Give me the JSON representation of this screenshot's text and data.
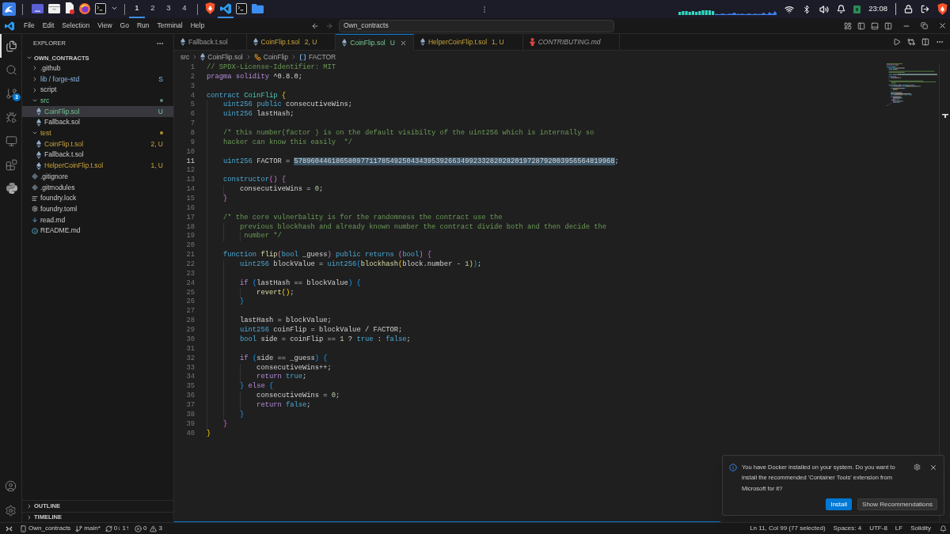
{
  "os_bar": {
    "launchers": [
      {
        "kind": "window",
        "active": false
      },
      {
        "kind": "files",
        "active": false
      },
      {
        "kind": "document",
        "active": false
      },
      {
        "kind": "globe",
        "active": false
      },
      {
        "kind": "terminal",
        "active": false
      },
      {
        "kind": "caret",
        "active": false
      }
    ],
    "workspaces": [
      {
        "label": "1",
        "selected": true
      },
      {
        "label": "2",
        "selected": false
      },
      {
        "label": "3",
        "selected": false
      },
      {
        "label": "4",
        "selected": false
      }
    ],
    "pinned": [
      {
        "kind": "shield",
        "active": false
      },
      {
        "kind": "editor",
        "active": true
      },
      {
        "kind": "terminal",
        "active": false
      },
      {
        "kind": "folder",
        "active": false
      }
    ],
    "clock": "23:08"
  },
  "title_bar": {
    "menus": [
      "File",
      "Edit",
      "Selection",
      "View",
      "Go",
      "Run",
      "Terminal",
      "Help"
    ],
    "search": {
      "value": "Own_contracts"
    }
  },
  "activity_bar": {
    "items": [
      {
        "kind": "files",
        "selected": true
      },
      {
        "kind": "search",
        "selected": false
      },
      {
        "kind": "scm",
        "selected": false,
        "badge": "3"
      },
      {
        "kind": "debug",
        "selected": false
      },
      {
        "kind": "remote",
        "selected": false
      },
      {
        "kind": "extensions",
        "selected": false
      },
      {
        "kind": "python",
        "selected": false
      }
    ]
  },
  "sidebar": {
    "title": "EXPLORER",
    "root": {
      "label": "OWN_CONTRACTS",
      "expanded": true
    },
    "tree": [
      {
        "kind": "folder",
        "label": ".github",
        "expanded": false,
        "selected": false,
        "dot": false,
        "untracked": false,
        "warning": false
      },
      {
        "kind": "submodule",
        "label": "lib / forge-std",
        "expanded": false,
        "selected": false,
        "dot": false,
        "untracked": false,
        "warning": false,
        "badge": "S"
      },
      {
        "kind": "folder",
        "label": "script",
        "expanded": false,
        "selected": false,
        "dot": false,
        "untracked": false,
        "warning": false
      },
      {
        "kind": "folder",
        "label": "src",
        "expanded": true,
        "selected": false,
        "dot": true,
        "untracked": true,
        "warning": false,
        "children": [
          {
            "kind": "sol",
            "label": "CoinFlip.sol",
            "selected": true,
            "untracked": true,
            "warning": false,
            "badge": "U"
          },
          {
            "kind": "sol",
            "label": "Fallback.sol",
            "selected": false,
            "untracked": false,
            "warning": false
          }
        ]
      },
      {
        "kind": "folder",
        "label": "test",
        "expanded": true,
        "selected": false,
        "dot": true,
        "warning": true,
        "children": [
          {
            "kind": "sol",
            "label": "CoinFlip.t.sol",
            "selected": false,
            "warning": true,
            "badge": "2, U"
          },
          {
            "kind": "sol",
            "label": "Fallback.t.sol",
            "selected": false,
            "untracked": false,
            "warning": false
          },
          {
            "kind": "sol",
            "label": "HelperCoinFlip.t.sol",
            "selected": false,
            "warning": true,
            "badge": "1, U"
          }
        ]
      },
      {
        "kind": "git",
        "label": ".gitignore",
        "selected": false,
        "untracked": false,
        "warning": false
      },
      {
        "kind": "git",
        "label": ".gitmodules",
        "selected": false,
        "untracked": false,
        "warning": false
      },
      {
        "kind": "lock",
        "label": "foundry.lock",
        "selected": false,
        "untracked": false,
        "warning": false
      },
      {
        "kind": "toml",
        "label": "foundry.toml",
        "selected": false,
        "untracked": false,
        "warning": false
      },
      {
        "kind": "markdown",
        "label": "read.md",
        "selected": false,
        "untracked": false,
        "warning": false
      },
      {
        "kind": "info",
        "label": "README.md",
        "selected": false,
        "untracked": false,
        "warning": false
      }
    ],
    "sections": [
      {
        "label": "OUTLINE",
        "expanded": false
      },
      {
        "label": "TIMELINE",
        "expanded": false
      }
    ]
  },
  "tabs": [
    {
      "label": "Fallback.t.sol",
      "kind": "sol",
      "selected": false,
      "preview": false,
      "untracked": false,
      "warning": false
    },
    {
      "label": "CoinFlip.t.sol",
      "badge": "2, U",
      "kind": "sol",
      "selected": false,
      "preview": false,
      "warning": true
    },
    {
      "label": "CoinFlip.sol",
      "badge": "U",
      "kind": "sol",
      "selected": true,
      "preview": false,
      "untracked": true,
      "warning": false
    },
    {
      "label": "HelperCoinFlip.t.sol",
      "badge": "1, U",
      "kind": "sol",
      "selected": false,
      "preview": false,
      "warning": true
    },
    {
      "label": "CONTRIBUTING.md",
      "kind": "contributing",
      "selected": false,
      "preview": true,
      "untracked": false,
      "warning": false
    }
  ],
  "breadcrumb": [
    {
      "kind": "folder",
      "label": "src"
    },
    {
      "kind": "file",
      "label": "CoinFlip.sol"
    },
    {
      "kind": "class",
      "label": "CoinFlip"
    },
    {
      "kind": "field",
      "label": "FACTOR"
    }
  ],
  "editor": {
    "lines": [
      {
        "number": "1",
        "active": false,
        "tokens": [
          {
            "kind": "comment",
            "text": "// SPDX-License-Identifier: MIT"
          }
        ]
      },
      {
        "number": "2",
        "active": false,
        "tokens": [
          {
            "kind": "control",
            "text": "pragma solidity "
          },
          {
            "kind": "plain",
            "text": "^0.8.0;"
          }
        ]
      },
      {
        "number": "3",
        "active": false
      },
      {
        "number": "4",
        "active": false,
        "tokens": [
          {
            "kind": "keyword",
            "text": "contract "
          },
          {
            "kind": "type",
            "text": "CoinFlip "
          },
          {
            "kind": "bracket1",
            "text": "{"
          }
        ]
      },
      {
        "number": "5",
        "active": false,
        "tokens": [
          {
            "kind": "keyword",
            "text": "    uint256 "
          },
          {
            "kind": "keyword",
            "text": "public "
          },
          {
            "kind": "plain",
            "text": "consecutiveWins;"
          }
        ]
      },
      {
        "number": "6",
        "active": false,
        "tokens": [
          {
            "kind": "keyword",
            "text": "    uint256 "
          },
          {
            "kind": "plain",
            "text": "lastHash;"
          }
        ]
      },
      {
        "number": "7",
        "active": false
      },
      {
        "number": "8",
        "active": false,
        "tokens": [
          {
            "kind": "comment",
            "text": "    /* this number(factor ) is on the default visibilty of the uint256 which is internally so"
          }
        ]
      },
      {
        "number": "9",
        "active": false,
        "tokens": [
          {
            "kind": "comment",
            "text": "    hacker can know this easily  */"
          }
        ]
      },
      {
        "number": "10",
        "active": false
      },
      {
        "number": "11",
        "active": true,
        "tokens": [
          {
            "kind": "keyword",
            "text": "    uint256 "
          },
          {
            "kind": "plain",
            "text": "FACTOR = "
          },
          {
            "kind": "selection",
            "text": "57896044618658097711785492504343953926634992332820282019728792003956564819968"
          },
          {
            "kind": "plain",
            "text": ";"
          }
        ]
      },
      {
        "number": "12",
        "active": false
      },
      {
        "number": "13",
        "active": false,
        "tokens": [
          {
            "kind": "keyword",
            "text": "    constructor"
          },
          {
            "kind": "bracket2",
            "text": "() {"
          }
        ]
      },
      {
        "number": "14",
        "active": false,
        "tokens": [
          {
            "kind": "plain",
            "text": "        consecutiveWins = "
          },
          {
            "kind": "number",
            "text": "0"
          },
          {
            "kind": "plain",
            "text": ";"
          }
        ]
      },
      {
        "number": "15",
        "active": false,
        "tokens": [
          {
            "kind": "bracket2",
            "text": "    }"
          }
        ]
      },
      {
        "number": "16",
        "active": false
      },
      {
        "number": "17",
        "active": false,
        "tokens": [
          {
            "kind": "comment",
            "text": "    /* the core vulnerbality is for the randomness the contract use the"
          }
        ]
      },
      {
        "number": "18",
        "active": false,
        "tokens": [
          {
            "kind": "comment",
            "text": "        previous blockhash and already known number the contract divide both and then decide the"
          }
        ]
      },
      {
        "number": "19",
        "active": false,
        "tokens": [
          {
            "kind": "comment",
            "text": "         number */"
          }
        ]
      },
      {
        "number": "20",
        "active": false
      },
      {
        "number": "21",
        "active": false,
        "tokens": [
          {
            "kind": "keyword",
            "text": "    function "
          },
          {
            "kind": "function",
            "text": "flip"
          },
          {
            "kind": "bracket2",
            "text": "("
          },
          {
            "kind": "keyword",
            "text": "bool "
          },
          {
            "kind": "plain",
            "text": "_guess"
          },
          {
            "kind": "bracket2",
            "text": ") "
          },
          {
            "kind": "keyword",
            "text": "public returns "
          },
          {
            "kind": "bracket2",
            "text": "("
          },
          {
            "kind": "keyword",
            "text": "bool"
          },
          {
            "kind": "bracket2",
            "text": ") {"
          }
        ]
      },
      {
        "number": "22",
        "active": false,
        "tokens": [
          {
            "kind": "keyword",
            "text": "        uint256 "
          },
          {
            "kind": "plain",
            "text": "blockValue = "
          },
          {
            "kind": "keyword",
            "text": "uint256"
          },
          {
            "kind": "bracket3",
            "text": "("
          },
          {
            "kind": "function",
            "text": "blockhash"
          },
          {
            "kind": "bracket1",
            "text": "("
          },
          {
            "kind": "plain",
            "text": "block.number - "
          },
          {
            "kind": "number",
            "text": "1"
          },
          {
            "kind": "bracket1",
            "text": ")"
          },
          {
            "kind": "bracket3",
            "text": ")"
          },
          {
            "kind": "plain",
            "text": ";"
          }
        ]
      },
      {
        "number": "23",
        "active": false
      },
      {
        "number": "24",
        "active": false,
        "tokens": [
          {
            "kind": "control",
            "text": "        if "
          },
          {
            "kind": "bracket3",
            "text": "("
          },
          {
            "kind": "plain",
            "text": "lastHash == blockValue"
          },
          {
            "kind": "bracket3",
            "text": ") {"
          }
        ]
      },
      {
        "number": "25",
        "active": false,
        "tokens": [
          {
            "kind": "function",
            "text": "            revert"
          },
          {
            "kind": "bracket1",
            "text": "()"
          },
          {
            "kind": "plain",
            "text": ";"
          }
        ]
      },
      {
        "number": "26",
        "active": false,
        "tokens": [
          {
            "kind": "bracket3",
            "text": "        }"
          }
        ]
      },
      {
        "number": "27",
        "active": false
      },
      {
        "number": "28",
        "active": false,
        "tokens": [
          {
            "kind": "plain",
            "text": "        lastHash = blockValue;"
          }
        ]
      },
      {
        "number": "29",
        "active": false,
        "tokens": [
          {
            "kind": "keyword",
            "text": "        uint256 "
          },
          {
            "kind": "plain",
            "text": "coinFlip = blockValue / FACTOR;"
          }
        ]
      },
      {
        "number": "30",
        "active": false,
        "tokens": [
          {
            "kind": "keyword",
            "text": "        bool "
          },
          {
            "kind": "plain",
            "text": "side = coinFlip == "
          },
          {
            "kind": "number",
            "text": "1"
          },
          {
            "kind": "plain",
            "text": " ? "
          },
          {
            "kind": "keyword",
            "text": "true"
          },
          {
            "kind": "plain",
            "text": " : "
          },
          {
            "kind": "keyword",
            "text": "false"
          },
          {
            "kind": "plain",
            "text": ";"
          }
        ]
      },
      {
        "number": "31",
        "active": false
      },
      {
        "number": "32",
        "active": false,
        "tokens": [
          {
            "kind": "control",
            "text": "        if "
          },
          {
            "kind": "bracket3",
            "text": "("
          },
          {
            "kind": "plain",
            "text": "side == _guess"
          },
          {
            "kind": "bracket3",
            "text": ") {"
          }
        ]
      },
      {
        "number": "33",
        "active": false,
        "tokens": [
          {
            "kind": "plain",
            "text": "            consecutiveWins++;"
          }
        ]
      },
      {
        "number": "34",
        "active": false,
        "tokens": [
          {
            "kind": "control",
            "text": "            return "
          },
          {
            "kind": "keyword",
            "text": "true"
          },
          {
            "kind": "plain",
            "text": ";"
          }
        ]
      },
      {
        "number": "35",
        "active": false,
        "tokens": [
          {
            "kind": "bracket3",
            "text": "        } "
          },
          {
            "kind": "control",
            "text": "else "
          },
          {
            "kind": "bracket3",
            "text": "{"
          }
        ]
      },
      {
        "number": "36",
        "active": false,
        "tokens": [
          {
            "kind": "plain",
            "text": "            consecutiveWins = "
          },
          {
            "kind": "number",
            "text": "0"
          },
          {
            "kind": "plain",
            "text": ";"
          }
        ]
      },
      {
        "number": "37",
        "active": false,
        "tokens": [
          {
            "kind": "control",
            "text": "            return "
          },
          {
            "kind": "keyword",
            "text": "false"
          },
          {
            "kind": "plain",
            "text": ";"
          }
        ]
      },
      {
        "number": "38",
        "active": false,
        "tokens": [
          {
            "kind": "bracket3",
            "text": "        }"
          }
        ]
      },
      {
        "number": "39",
        "active": false,
        "tokens": [
          {
            "kind": "bracket2",
            "text": "    }"
          }
        ]
      },
      {
        "number": "40",
        "active": false,
        "tokens": [
          {
            "kind": "bracket1",
            "text": "}"
          }
        ]
      }
    ]
  },
  "notification": {
    "message": "You have Docker installed on your system. Do you want to install the recommended 'Container Tools' extension from Microsoft for it?",
    "buttons": [
      {
        "label": "Install",
        "primary": true
      },
      {
        "label": "Show Recommendations",
        "primary": false
      }
    ]
  },
  "status_bar": {
    "left": [
      {
        "kind": "device",
        "label": "Own_contracts"
      },
      {
        "kind": "branch",
        "label": "main*"
      },
      {
        "kind": "sync",
        "label": "0↓ 1↑"
      }
    ],
    "problems": {
      "errors": "0",
      "warnings": "3"
    },
    "right": [
      "Ln 11, Col 99 (77 selected)",
      "Spaces: 4",
      "UTF-8",
      "LF",
      "Solidity"
    ]
  }
}
